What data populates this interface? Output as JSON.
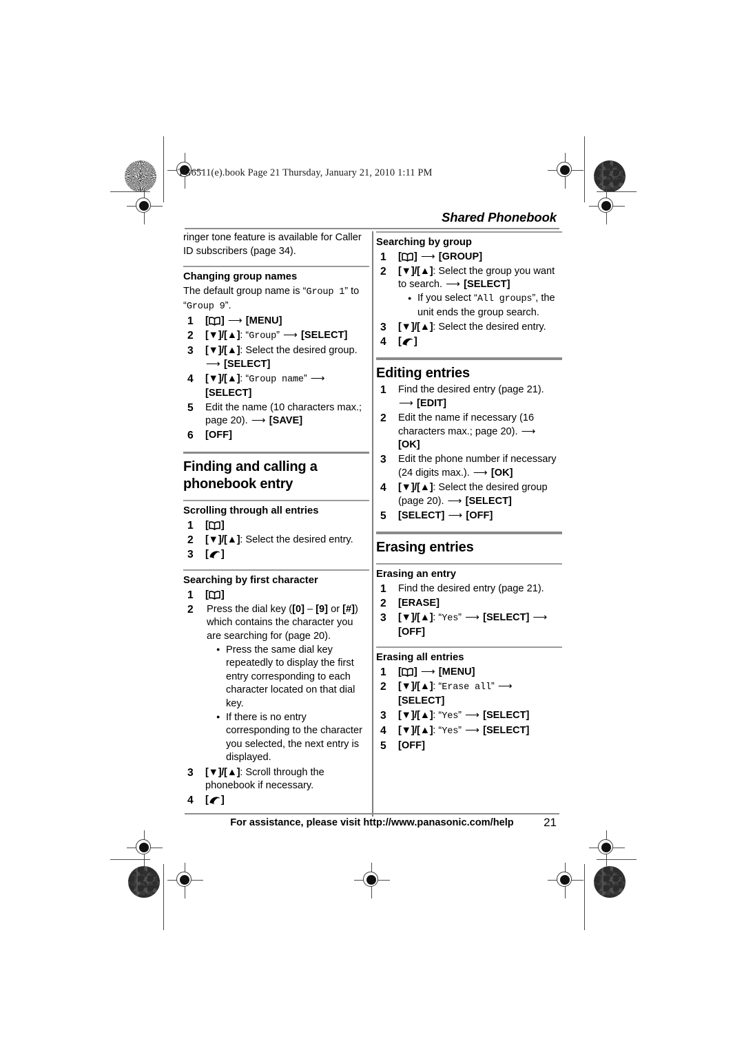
{
  "header": {
    "book_line": "TG6511(e).book  Page 21  Thursday, January 21, 2010  1:11 PM",
    "running_head": "Shared Phonebook"
  },
  "footer": {
    "assistance": "For assistance, please visit http://www.panasonic.com/help",
    "page_number": "21"
  },
  "left_column": {
    "continued_paragraph": "ringer tone feature is available for Caller ID subscribers (page 34).",
    "section_changing_group_names": {
      "heading": "Changing group names",
      "intro_prefix": "The default group name is ",
      "intro_value_1": "Group 1",
      "intro_middle": " to ",
      "intro_value_2": "Group 9",
      "intro_suffix": ".",
      "steps": [
        {
          "num": "1",
          "key_icon": "phonebook",
          "arrow": "⟶",
          "key_label": "MENU"
        },
        {
          "num": "2",
          "nav": "[▼]/[▲]",
          "text": ": ",
          "quoted_mono": "Group",
          "arrow": "⟶",
          "key_label": "SELECT"
        },
        {
          "num": "3",
          "nav": "[▼]/[▲]",
          "text": ": Select the desired group.",
          "arrow": "⟶",
          "key_label": "SELECT"
        },
        {
          "num": "4",
          "nav": "[▼]/[▲]",
          "text": ": ",
          "quoted_mono": "Group name",
          "arrow": "⟶",
          "key_label": "SELECT"
        },
        {
          "num": "5",
          "text": "Edit the name (10 characters max.; page 20). ",
          "arrow": "⟶",
          "key_label": "SAVE"
        },
        {
          "num": "6",
          "key_label": "OFF"
        }
      ]
    },
    "section_finding_calling": {
      "heading": "Finding and calling a phonebook entry",
      "sub_scrolling": {
        "heading": "Scrolling through all entries",
        "steps": [
          {
            "num": "1",
            "key_icon": "phonebook"
          },
          {
            "num": "2",
            "nav": "[▼]/[▲]",
            "text": ": Select the desired entry."
          },
          {
            "num": "3",
            "key_icon": "talk"
          }
        ]
      },
      "sub_first_char": {
        "heading": "Searching by first character",
        "steps": [
          {
            "num": "1",
            "key_icon": "phonebook"
          },
          {
            "num": "2",
            "text_a": "Press the dial key (",
            "k0": "[0]",
            "dash": " – ",
            "k9": "[9]",
            "text_b": " or ",
            "khash": "[#]",
            "text_c": ") which contains the character you are searching for (page 20).",
            "bullets": [
              "Press the same dial key repeatedly to display the first entry corresponding to each character located on that dial key.",
              "If there is no entry corresponding to the character you selected, the next entry is displayed."
            ]
          },
          {
            "num": "3",
            "nav": "[▼]/[▲]",
            "text": ": Scroll through the phonebook if necessary."
          },
          {
            "num": "4",
            "key_icon": "talk"
          }
        ]
      }
    }
  },
  "right_column": {
    "sub_searching_group": {
      "heading": "Searching by group",
      "steps": [
        {
          "num": "1",
          "key_icon": "phonebook",
          "arrow": "⟶",
          "key_label": "GROUP"
        },
        {
          "num": "2",
          "nav": "[▼]/[▲]",
          "text": ": Select the group you want to search. ",
          "arrow": "⟶",
          "key_label": "SELECT",
          "bullets_prefix": "If you select ",
          "bullets_mono": "All groups",
          "bullets_suffix": ", the unit ends the group search."
        },
        {
          "num": "3",
          "nav": "[▼]/[▲]",
          "text": ": Select the desired entry."
        },
        {
          "num": "4",
          "key_icon": "talk"
        }
      ]
    },
    "section_editing_entries": {
      "heading": "Editing entries",
      "steps": [
        {
          "num": "1",
          "text": "Find the desired entry (page 21). ",
          "arrow": "⟶",
          "key_label": "EDIT"
        },
        {
          "num": "2",
          "text": "Edit the name if necessary (16 characters max.; page 20). ",
          "arrow": "⟶",
          "key_label": "OK"
        },
        {
          "num": "3",
          "text": "Edit the phone number if necessary (24 digits max.). ",
          "arrow": "⟶",
          "key_label": "OK"
        },
        {
          "num": "4",
          "nav": "[▼]/[▲]",
          "text": ": Select the desired group (page 20). ",
          "arrow": "⟶",
          "key_label": "SELECT"
        },
        {
          "num": "5",
          "key_label_first": "SELECT",
          "arrow": "⟶",
          "key_label": "OFF"
        }
      ]
    },
    "section_erasing_entries": {
      "heading": "Erasing entries",
      "sub_erase_one": {
        "heading": "Erasing an entry",
        "steps": [
          {
            "num": "1",
            "text": "Find the desired entry (page 21)."
          },
          {
            "num": "2",
            "key_label": "ERASE"
          },
          {
            "num": "3",
            "nav": "[▼]/[▲]",
            "text": ": ",
            "quoted_mono": "Yes",
            "arrow": "⟶",
            "key_label": "SELECT",
            "arrow2": "⟶",
            "key_label2": "OFF"
          }
        ]
      },
      "sub_erase_all": {
        "heading": "Erasing all entries",
        "steps": [
          {
            "num": "1",
            "key_icon": "phonebook",
            "arrow": "⟶",
            "key_label": "MENU"
          },
          {
            "num": "2",
            "nav": "[▼]/[▲]",
            "text": ": ",
            "quoted_mono": "Erase all",
            "arrow": "⟶",
            "key_label": "SELECT"
          },
          {
            "num": "3",
            "nav": "[▼]/[▲]",
            "text": ": ",
            "quoted_mono": "Yes",
            "arrow": "⟶",
            "key_label": "SELECT"
          },
          {
            "num": "4",
            "nav": "[▼]/[▲]",
            "text": ": ",
            "quoted_mono": "Yes",
            "arrow": "⟶",
            "key_label": "SELECT"
          },
          {
            "num": "5",
            "key_label": "OFF"
          }
        ]
      }
    }
  }
}
